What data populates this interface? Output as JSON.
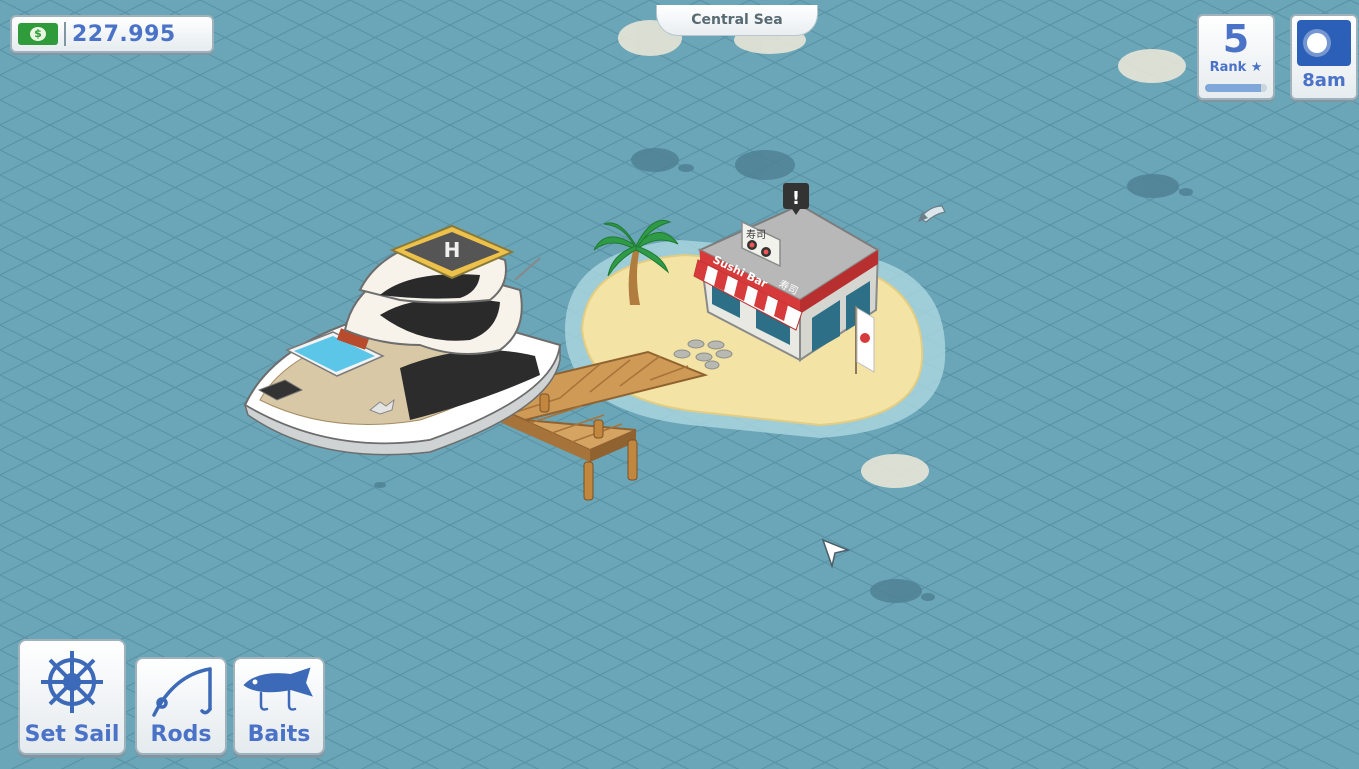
{
  "hud": {
    "money": "227.995",
    "money_icon": "cash-icon",
    "region": "Central Sea",
    "rank": {
      "value": "5",
      "label": "Rank ★",
      "progress": 0.9
    },
    "time": "8am",
    "time_icon": "sun-icon"
  },
  "buttons": [
    {
      "id": "set-sail",
      "label": "Set Sail",
      "icon": "ship-wheel-icon"
    },
    {
      "id": "rods",
      "label": "Rods",
      "icon": "fishing-rod-icon"
    },
    {
      "id": "baits",
      "label": "Baits",
      "icon": "fish-lure-icon"
    }
  ],
  "world": {
    "shop_sign": "Sushi Bar",
    "shop_sign_kanji": "寿司",
    "shop_board": "寿司",
    "alert": "!",
    "colors": {
      "sea": "#6aa6b8",
      "grid": "#5b93a6",
      "sand": "#f3e3a4",
      "awning_red": "#d63a3a"
    }
  }
}
